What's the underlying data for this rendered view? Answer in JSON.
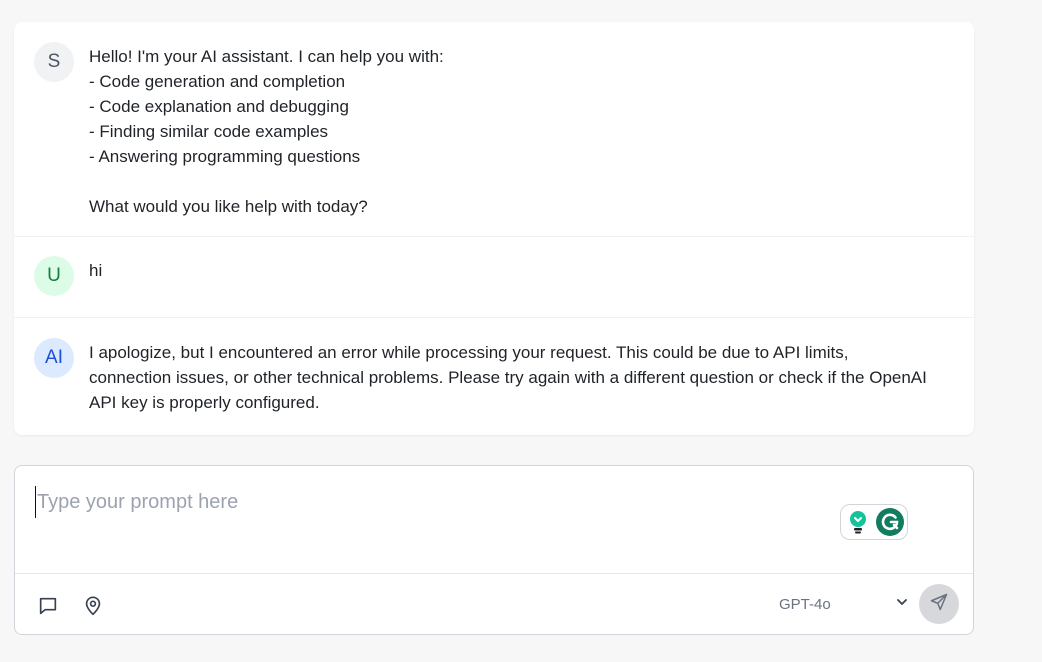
{
  "messages": [
    {
      "role": "system",
      "avatar": "S",
      "lines": [
        "Hello! I'm your AI assistant. I can help you with:",
        "- Code generation and completion",
        "- Code explanation and debugging",
        "- Finding similar code examples",
        "- Answering programming questions",
        "",
        "What would you like help with today?"
      ]
    },
    {
      "role": "user",
      "avatar": "U",
      "text": "hi"
    },
    {
      "role": "assistant",
      "avatar": "AI",
      "lines": [
        "I apologize, but I encountered an error while processing your request. This could be due to API limits,",
        "connection issues, or other technical problems. Please try again with a different question or check if the OpenAI",
        "API key is properly configured."
      ]
    }
  ],
  "composer": {
    "placeholder": "Type your prompt here",
    "value": "",
    "model": "GPT-4o",
    "icons": {
      "chat": "chat-bubble-icon",
      "location": "map-pin-icon",
      "dropdown": "chevron-down-icon",
      "send": "send-icon",
      "grammarly_bulb": "lightbulb-icon",
      "grammarly_logo": "grammarly-g-icon"
    }
  },
  "colors": {
    "page_bg": "#f7f7f8",
    "user_avatar_bg": "#dcfce7",
    "ai_avatar_bg": "#dbeafe",
    "system_avatar_bg": "#f1f2f4",
    "grammarly_green": "#127c61",
    "grammarly_bulb": "#15c39a"
  }
}
